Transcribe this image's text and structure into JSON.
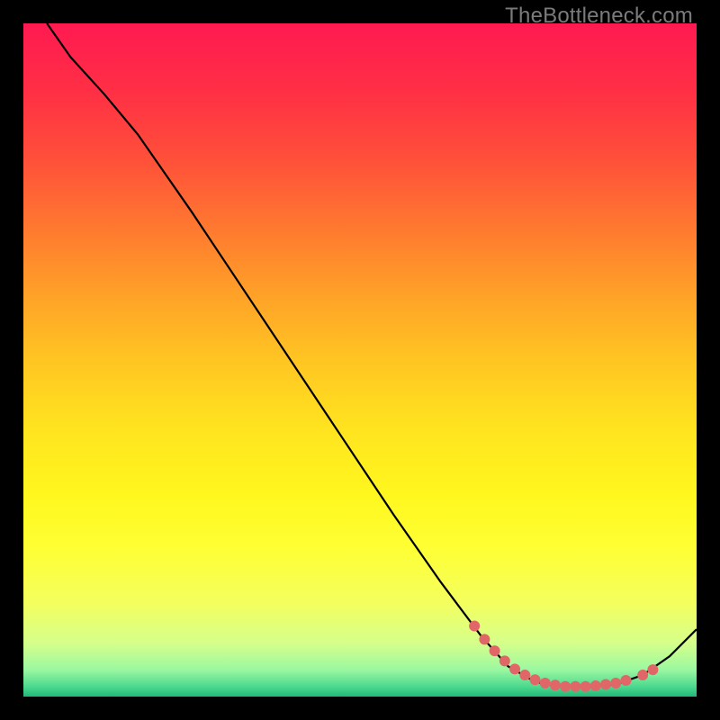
{
  "watermark": "TheBottleneck.com",
  "chart_data": {
    "type": "line",
    "title": "",
    "xlabel": "",
    "ylabel": "",
    "xlim": [
      0,
      100
    ],
    "ylim": [
      0,
      100
    ],
    "grid": false,
    "legend": false,
    "gradient_stops": [
      {
        "offset": 0.0,
        "color": "#ff1a51"
      },
      {
        "offset": 0.1,
        "color": "#ff2f45"
      },
      {
        "offset": 0.2,
        "color": "#ff4f3a"
      },
      {
        "offset": 0.3,
        "color": "#ff7730"
      },
      {
        "offset": 0.4,
        "color": "#ffa028"
      },
      {
        "offset": 0.5,
        "color": "#ffc522"
      },
      {
        "offset": 0.6,
        "color": "#ffe31f"
      },
      {
        "offset": 0.7,
        "color": "#fff71e"
      },
      {
        "offset": 0.78,
        "color": "#feff34"
      },
      {
        "offset": 0.86,
        "color": "#f4ff5e"
      },
      {
        "offset": 0.92,
        "color": "#d6ff8a"
      },
      {
        "offset": 0.96,
        "color": "#9bf8a0"
      },
      {
        "offset": 0.985,
        "color": "#4dd98f"
      },
      {
        "offset": 1.0,
        "color": "#1fb877"
      }
    ],
    "series": [
      {
        "name": "curve",
        "stroke": "#000000",
        "points": [
          {
            "x": 3.5,
            "y": 100.0
          },
          {
            "x": 7.0,
            "y": 95.0
          },
          {
            "x": 12.0,
            "y": 89.5
          },
          {
            "x": 17.0,
            "y": 83.5
          },
          {
            "x": 25.0,
            "y": 72.0
          },
          {
            "x": 35.0,
            "y": 57.0
          },
          {
            "x": 45.0,
            "y": 42.0
          },
          {
            "x": 55.0,
            "y": 27.0
          },
          {
            "x": 62.0,
            "y": 17.0
          },
          {
            "x": 68.0,
            "y": 9.0
          },
          {
            "x": 72.0,
            "y": 4.5
          },
          {
            "x": 76.0,
            "y": 2.2
          },
          {
            "x": 80.0,
            "y": 1.5
          },
          {
            "x": 84.0,
            "y": 1.5
          },
          {
            "x": 88.0,
            "y": 1.8
          },
          {
            "x": 92.0,
            "y": 3.2
          },
          {
            "x": 96.0,
            "y": 6.0
          },
          {
            "x": 100.0,
            "y": 10.0
          }
        ]
      }
    ],
    "markers": {
      "name": "highlight-dots",
      "color": "#e16667",
      "radius": 6,
      "points": [
        {
          "x": 67.0,
          "y": 10.5
        },
        {
          "x": 68.5,
          "y": 8.5
        },
        {
          "x": 70.0,
          "y": 6.8
        },
        {
          "x": 71.5,
          "y": 5.3
        },
        {
          "x": 73.0,
          "y": 4.1
        },
        {
          "x": 74.5,
          "y": 3.2
        },
        {
          "x": 76.0,
          "y": 2.5
        },
        {
          "x": 77.5,
          "y": 2.0
        },
        {
          "x": 79.0,
          "y": 1.7
        },
        {
          "x": 80.5,
          "y": 1.5
        },
        {
          "x": 82.0,
          "y": 1.5
        },
        {
          "x": 83.5,
          "y": 1.5
        },
        {
          "x": 85.0,
          "y": 1.6
        },
        {
          "x": 86.5,
          "y": 1.8
        },
        {
          "x": 88.0,
          "y": 2.0
        },
        {
          "x": 89.5,
          "y": 2.4
        },
        {
          "x": 92.0,
          "y": 3.2
        },
        {
          "x": 93.5,
          "y": 4.0
        }
      ]
    }
  }
}
